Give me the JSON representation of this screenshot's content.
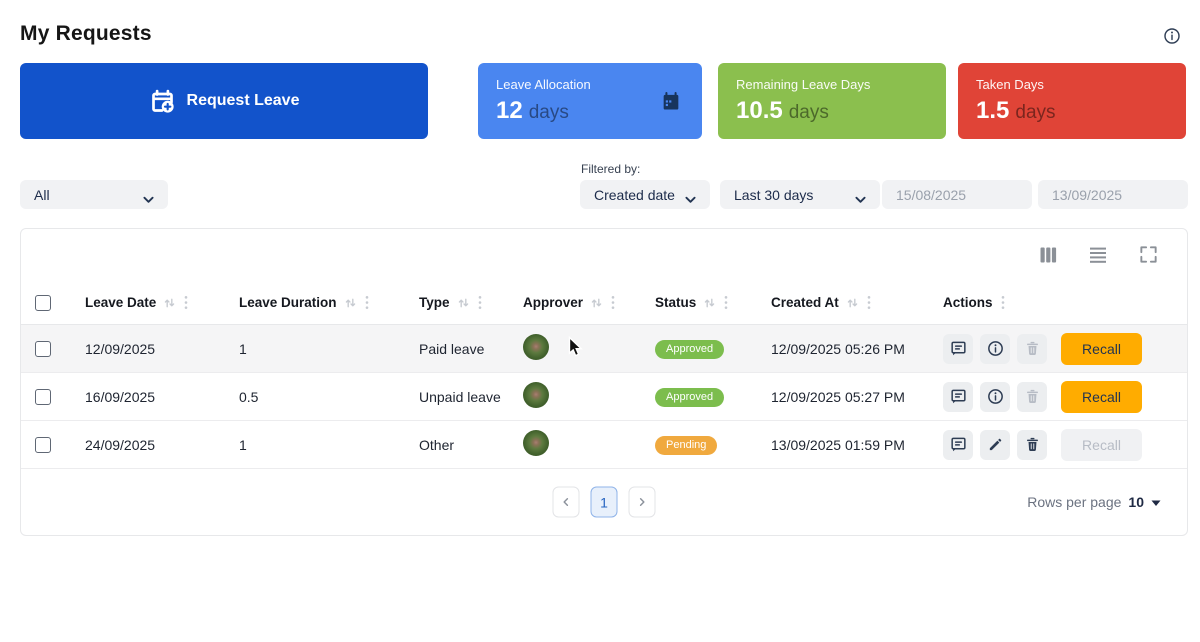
{
  "page": {
    "title": "My Requests"
  },
  "actions_bar": {
    "request_leave_label": "Request Leave"
  },
  "summary_cards": [
    {
      "label": "Leave Allocation",
      "value": "12",
      "unit": "days",
      "color": "#4a86f0"
    },
    {
      "label": "Remaining Leave Days",
      "value": "10.5",
      "unit": "days",
      "color": "#8bbf4e"
    },
    {
      "label": "Taken Days",
      "value": "1.5",
      "unit": "days",
      "color": "#e04437"
    }
  ],
  "filters": {
    "type_filter_value": "All",
    "filtered_by_label": "Filtered by:",
    "field_filter_value": "Created date",
    "range_filter_value": "Last 30 days",
    "date_from": "15/08/2025",
    "date_to": "13/09/2025"
  },
  "table": {
    "columns": [
      "Leave Date",
      "Leave Duration",
      "Type",
      "Approver",
      "Status",
      "Created At",
      "Actions"
    ],
    "recall_label": "Recall",
    "rows": [
      {
        "leave_date": "12/09/2025",
        "leave_duration": "1",
        "type": "Paid leave",
        "status": "Approved",
        "created_at": "12/09/2025 05:26 PM",
        "second_action": "info",
        "delete_enabled": false,
        "recall_enabled": true,
        "highlighted": true
      },
      {
        "leave_date": "16/09/2025",
        "leave_duration": "0.5",
        "type": "Unpaid leave",
        "status": "Approved",
        "created_at": "12/09/2025 05:27 PM",
        "second_action": "info",
        "delete_enabled": false,
        "recall_enabled": true,
        "highlighted": false
      },
      {
        "leave_date": "24/09/2025",
        "leave_duration": "1",
        "type": "Other",
        "status": "Pending",
        "created_at": "13/09/2025 01:59 PM",
        "second_action": "edit",
        "delete_enabled": true,
        "recall_enabled": false,
        "highlighted": false
      }
    ]
  },
  "pagination": {
    "current_page": "1",
    "rows_per_page_label": "Rows per page",
    "rows_per_page_value": "10"
  },
  "colors": {
    "primary_blue": "#1253cb",
    "card_blue": "#4a86f0",
    "card_green": "#8bbf4e",
    "card_red": "#e04437",
    "recall_amber": "#ffac00",
    "badge_approved": "#7cbd4d",
    "badge_pending": "#f0a93e"
  }
}
